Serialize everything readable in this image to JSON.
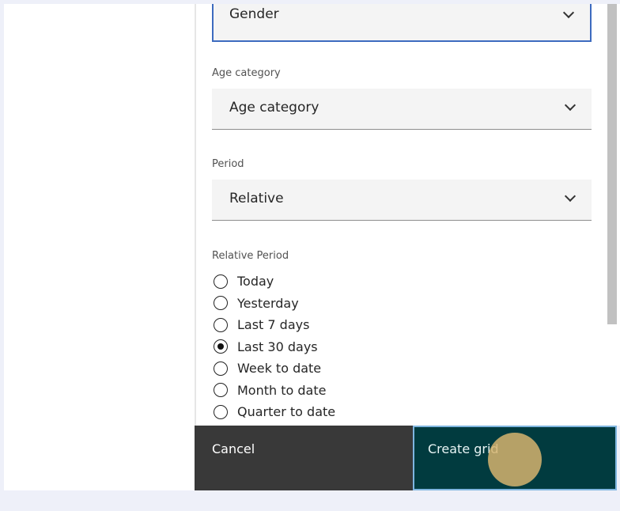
{
  "fields": {
    "gender": {
      "value": "Gender"
    },
    "age": {
      "label": "Age category",
      "value": "Age category"
    },
    "period": {
      "label": "Period",
      "value": "Relative"
    }
  },
  "relative_period": {
    "label": "Relative Period",
    "options": [
      "Today",
      "Yesterday",
      "Last 7 days",
      "Last 30 days",
      "Week to date",
      "Month to date",
      "Quarter to date"
    ],
    "selected": "Last 30 days"
  },
  "buttons": {
    "cancel": "Cancel",
    "create": "Create grid"
  }
}
